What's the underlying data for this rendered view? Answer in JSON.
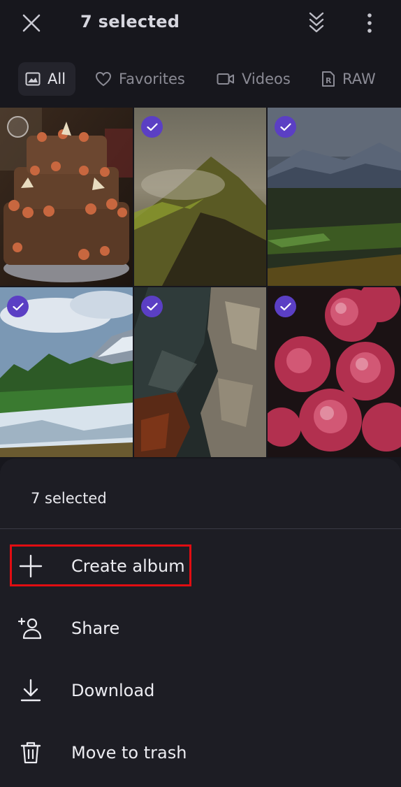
{
  "header": {
    "title": "7 selected",
    "icons": [
      "close-icon",
      "select-all-icon",
      "more-vert-icon"
    ]
  },
  "tabs": [
    {
      "label": "All",
      "icon": "image-icon",
      "active": true
    },
    {
      "label": "Favorites",
      "icon": "heart-icon",
      "active": false
    },
    {
      "label": "Videos",
      "icon": "video-icon",
      "active": false
    },
    {
      "label": "RAW",
      "icon": "raw-icon",
      "active": false
    }
  ],
  "grid": {
    "photos": [
      {
        "subject": "cake",
        "selected": false
      },
      {
        "subject": "misty-mountain",
        "selected": true
      },
      {
        "subject": "forest-valley",
        "selected": true
      },
      {
        "subject": "river-rapids",
        "selected": true
      },
      {
        "subject": "rocky-stream",
        "selected": true
      },
      {
        "subject": "red-flowers",
        "selected": true
      }
    ]
  },
  "sheet": {
    "title": "7 selected",
    "actions": [
      {
        "label": "Create album",
        "icon": "plus-icon",
        "highlighted": true
      },
      {
        "label": "Share",
        "icon": "share-person-icon",
        "highlighted": false
      },
      {
        "label": "Download",
        "icon": "download-icon",
        "highlighted": false
      },
      {
        "label": "Move to trash",
        "icon": "trash-icon",
        "highlighted": false
      }
    ]
  },
  "colors": {
    "background": "#17171d",
    "sheet": "#1d1d24",
    "accent_check": "#5b3fc4",
    "highlight_box": "#e10d12"
  }
}
